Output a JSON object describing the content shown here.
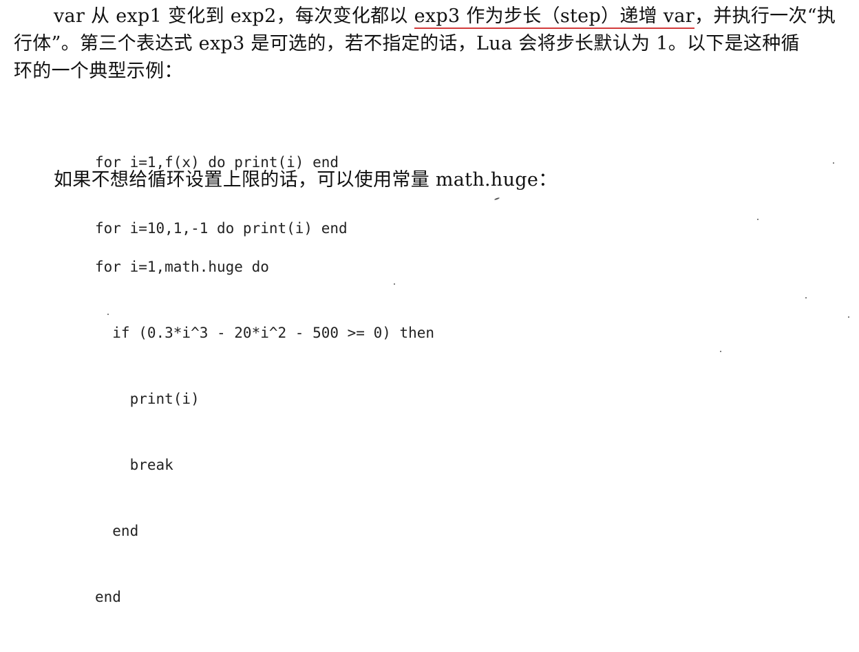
{
  "paragraph1": {
    "line1_pre": "var 从 exp1 变化到 exp2，每次变化都以 ",
    "line1_highlight": "exp3 作为步长（step）递增 var",
    "line1_post": "，并执行一次“执",
    "line2": "行体”。第三个表达式 exp3 是可选的，若不指定的话，Lua 会将步长默认为 1。以下是这种循",
    "line3": "环的一个典型示例："
  },
  "code_block_1": {
    "lines": [
      "for i=1,f(x) do print(i) end",
      "for i=10,1,-1 do print(i) end"
    ]
  },
  "paragraph2": {
    "text": "如果不想给循环设置上限的话，可以使用常量 math.huge："
  },
  "code_block_2": {
    "lines": [
      "for i=1,math.huge do",
      "  if (0.3*i^3 - 20*i^2 - 500 >= 0) then",
      "    print(i)",
      "    break",
      "  end",
      "end"
    ]
  },
  "colors": {
    "text": "#111111",
    "underline": "#d23a3a"
  }
}
